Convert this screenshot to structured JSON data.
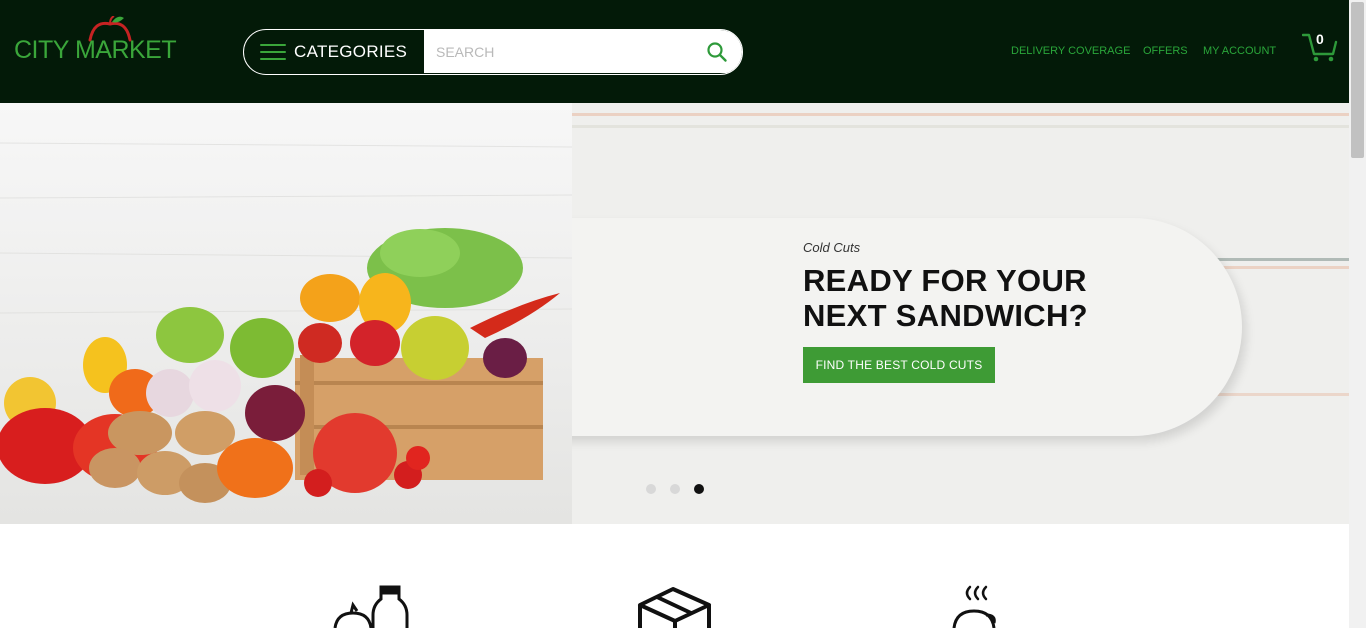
{
  "header": {
    "logo_text": "CITY MARKET",
    "categories_label": "CATEGORIES",
    "search_placeholder": "SEARCH",
    "nav": [
      "DELIVERY COVERAGE",
      "OFFERS",
      "MY ACCOUNT"
    ],
    "cart_count": "0"
  },
  "hero": {
    "kicker": "Cold Cuts",
    "title": "READY FOR YOUR NEXT SANDWICH?",
    "cta_label": "FIND THE BEST COLD CUTS",
    "slides": 3,
    "active_slide": 3
  },
  "features": {
    "icons": [
      "grocery-bottle-icon",
      "box-icon",
      "hot-food-icon"
    ]
  },
  "colors": {
    "header_bg": "#031a08",
    "accent_green": "#3e9b35",
    "nav_green": "#2aa63a"
  }
}
